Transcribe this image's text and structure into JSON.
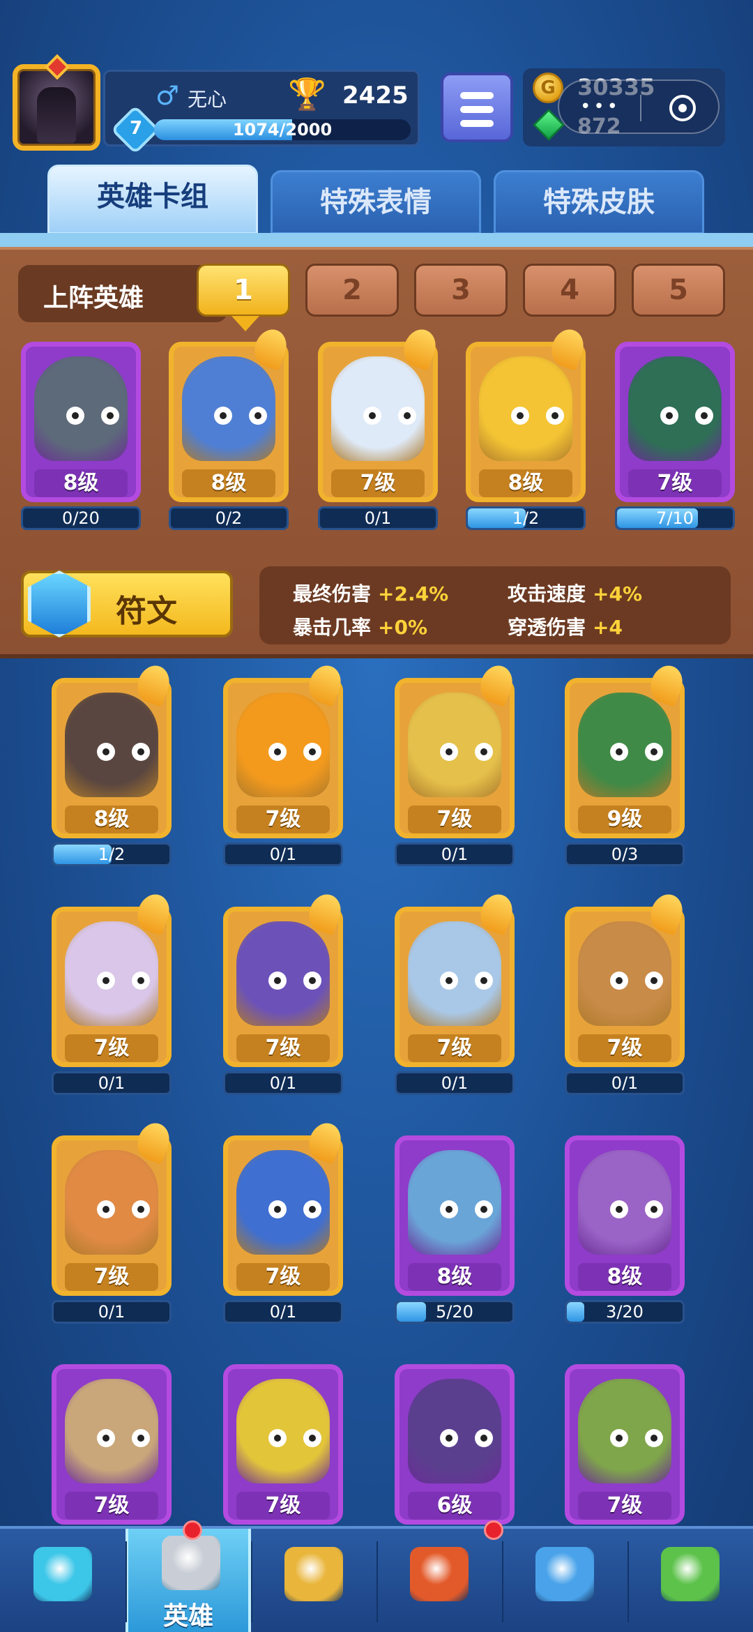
{
  "profile": {
    "name": "无心",
    "gender_icon": "male-symbol",
    "trophies": "2425",
    "level": "7",
    "xp_text": "1074/2000",
    "xp_fraction": 0.537
  },
  "currency": {
    "coins": "30335",
    "gems": "872",
    "coin_glyph": "G"
  },
  "tabs": [
    {
      "label": "英雄卡组",
      "active": true
    },
    {
      "label": "特殊表情",
      "active": false
    },
    {
      "label": "特殊皮肤",
      "active": false
    }
  ],
  "lineup": {
    "label": "上阵英雄",
    "slots": [
      "1",
      "2",
      "3",
      "4",
      "5"
    ],
    "active_slot": 0,
    "heroes": [
      {
        "level": "8级",
        "progress": "0/20",
        "fraction": 0,
        "rarity": "epic",
        "color": "#5d6a7a"
      },
      {
        "level": "8级",
        "progress": "0/2",
        "fraction": 0,
        "rarity": "legendary",
        "color": "#4f7fd4"
      },
      {
        "level": "7级",
        "progress": "0/1",
        "fraction": 0,
        "rarity": "legendary",
        "color": "#dfeaf8"
      },
      {
        "level": "8级",
        "progress": "1/2",
        "fraction": 0.5,
        "rarity": "legendary",
        "color": "#f4c434"
      },
      {
        "level": "7级",
        "progress": "7/10",
        "fraction": 0.7,
        "rarity": "epic",
        "color": "#2e6f56"
      }
    ]
  },
  "rune": {
    "label": "符文",
    "stats": [
      {
        "name": "最终伤害",
        "value": "+2.4%"
      },
      {
        "name": "攻击速度",
        "value": "+4%"
      },
      {
        "name": "暴击几率",
        "value": "+0%"
      },
      {
        "name": "穿透伤害",
        "value": "+4"
      }
    ]
  },
  "collection": [
    {
      "level": "8级",
      "progress": "1/2",
      "fraction": 0.5,
      "rarity": "legendary",
      "color": "#5a4640"
    },
    {
      "level": "7级",
      "progress": "0/1",
      "fraction": 0,
      "rarity": "legendary",
      "color": "#f39a1d"
    },
    {
      "level": "7级",
      "progress": "0/1",
      "fraction": 0,
      "rarity": "legendary",
      "color": "#e5c14b"
    },
    {
      "level": "9级",
      "progress": "0/3",
      "fraction": 0,
      "rarity": "legendary",
      "color": "#3f8a47"
    },
    {
      "level": "7级",
      "progress": "0/1",
      "fraction": 0,
      "rarity": "legendary",
      "color": "#d9c6e8"
    },
    {
      "level": "7级",
      "progress": "0/1",
      "fraction": 0,
      "rarity": "legendary",
      "color": "#6c52b8"
    },
    {
      "level": "7级",
      "progress": "0/1",
      "fraction": 0,
      "rarity": "legendary",
      "color": "#a9c8e8"
    },
    {
      "level": "7级",
      "progress": "0/1",
      "fraction": 0,
      "rarity": "legendary",
      "color": "#c98b48"
    },
    {
      "level": "7级",
      "progress": "0/1",
      "fraction": 0,
      "rarity": "legendary",
      "color": "#e08a44"
    },
    {
      "level": "7级",
      "progress": "0/1",
      "fraction": 0,
      "rarity": "legendary",
      "color": "#3f6fd1"
    },
    {
      "level": "8级",
      "progress": "5/20",
      "fraction": 0.25,
      "rarity": "epic",
      "color": "#6aa5d8"
    },
    {
      "level": "8级",
      "progress": "3/20",
      "fraction": 0.15,
      "rarity": "epic",
      "color": "#9a64c6"
    },
    {
      "level": "7级",
      "progress": "",
      "fraction": 0,
      "rarity": "epic",
      "color": "#c9a77a"
    },
    {
      "level": "7级",
      "progress": "",
      "fraction": 0,
      "rarity": "epic",
      "color": "#e3c53a"
    },
    {
      "level": "6级",
      "progress": "",
      "fraction": 0,
      "rarity": "epic",
      "color": "#5b3f8f"
    },
    {
      "level": "7级",
      "progress": "",
      "fraction": 0,
      "rarity": "epic",
      "color": "#7fa64a"
    }
  ],
  "nav": {
    "items": [
      {
        "icon": "treasure-chest-icon",
        "label": "",
        "active": false,
        "color": "#3cc6e8"
      },
      {
        "icon": "knight-helmet-icon",
        "label": "英雄",
        "active": true,
        "color": "#c9ced6"
      },
      {
        "icon": "crossed-swords-icon",
        "label": "",
        "active": false,
        "color": "#e9b53a"
      },
      {
        "icon": "crown-shield-icon",
        "label": "",
        "active": false,
        "color": "#e35a2a"
      },
      {
        "icon": "team-banner-icon",
        "label": "",
        "active": false,
        "color": "#4aa3ea"
      },
      {
        "icon": "sprout-island-icon",
        "label": "",
        "active": false,
        "color": "#5cc24a"
      }
    ]
  }
}
